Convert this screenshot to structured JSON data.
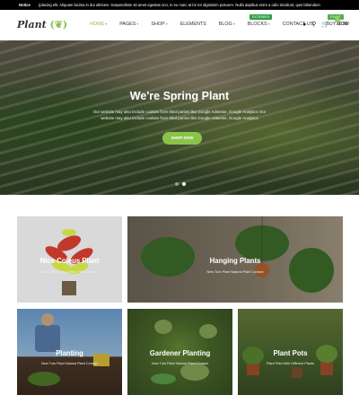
{
  "notice": {
    "label": "Notice",
    "text": "(placing elit. Aliquam lacinia in dui ultricies. Suspendisse sit amet egestas orci, in eu nunc at lor tor dignissim posuere. Nulla dapibus enim a odio tincidunt, quis bibendum"
  },
  "header": {
    "logo": "Plant",
    "nav": [
      {
        "label": "HOME",
        "has_dropdown": true,
        "active": true
      },
      {
        "label": "PAGES",
        "has_dropdown": true
      },
      {
        "label": "SHOP",
        "has_dropdown": true
      },
      {
        "label": "ELEMENTS"
      },
      {
        "label": "BLOG",
        "has_dropdown": true
      },
      {
        "label": "BLOCKS",
        "has_dropdown": true,
        "tag": "EXTENDED"
      },
      {
        "label": "CONTACT US"
      },
      {
        "label": "BUY NOW",
        "tag": "PLANT"
      }
    ],
    "cart_count": "0",
    "cart_total": "£0.00",
    "icons": [
      "user-icon",
      "search-icon",
      "cart-icon"
    ]
  },
  "hero": {
    "title": "We're Spring Plant",
    "text": "Our website may also include cookies from third parties like Google Adsense, Google Analytics Our website may also include cookies from third parties like Google Adsense, Google Analytics",
    "button": "SHOP NOW",
    "slides": 2,
    "active_slide": 2
  },
  "categories": [
    {
      "title": "Nice Coleus Plant",
      "subtitle": "New Turs Fluffy Coleus Plant Contact"
    },
    {
      "title": "Hanging Plants",
      "subtitle": "New Turs Plant Natural Plant Contact"
    },
    {
      "title": "Planting",
      "subtitle": "New Turs Plant Natural Plant Contact"
    },
    {
      "title": "Gardener Planting",
      "subtitle": "New Turs Plant Natural Plant Contact"
    },
    {
      "title": "Plant Pots",
      "subtitle": "Plant Pots With Different Plants"
    }
  ],
  "colors": {
    "accent": "#8bc34a",
    "tag_extended": "#2f9e44",
    "tag_plant": "#4caf50",
    "notice_bg": "#000000"
  }
}
